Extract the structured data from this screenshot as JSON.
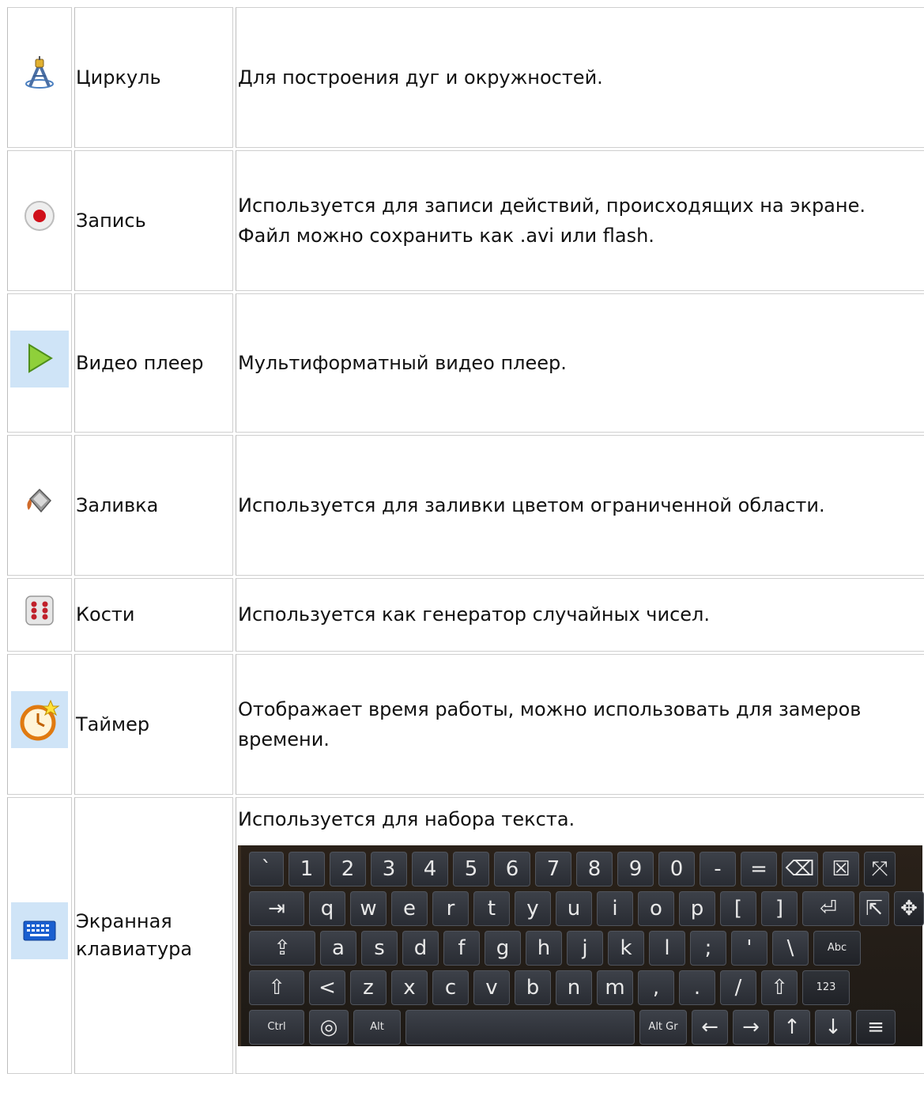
{
  "rows": [
    {
      "icon": "compass-icon",
      "name": "Циркуль",
      "desc": [
        "Для построения дуг и окружностей."
      ]
    },
    {
      "icon": "record-icon",
      "name": "Запись",
      "desc": [
        "Используется для записи действий, происходящих на экране.",
        "Файл можно сохранить как .avi или flash."
      ]
    },
    {
      "icon": "play-icon",
      "name": "Видео плеер",
      "desc": [
        "Мультиформатный видео плеер."
      ]
    },
    {
      "icon": "paint-bucket-icon",
      "name": "Заливка",
      "desc": [
        "Используется для заливки цветом ограниченной области."
      ]
    },
    {
      "icon": "dice-icon",
      "name": "Кости",
      "desc": [
        "Используется как генератор случайных чисел."
      ]
    },
    {
      "icon": "timer-icon",
      "name": "Таймер",
      "desc": [
        "Отображает время работы, можно использовать для замеров",
        "времени."
      ]
    },
    {
      "icon": "keyboard-icon",
      "name_lines": [
        "Экранная",
        "клавиатура"
      ],
      "desc": [
        "Используется для набора текста."
      ]
    }
  ],
  "keyboard": {
    "rows": [
      [
        "`",
        "1",
        "2",
        "3",
        "4",
        "5",
        "6",
        "7",
        "8",
        "9",
        "0",
        "-",
        "=",
        "⌫",
        "☒",
        "⤧"
      ],
      [
        "⇥",
        "q",
        "w",
        "e",
        "r",
        "t",
        "y",
        "u",
        "i",
        "o",
        "p",
        "[",
        "]",
        "⏎",
        "⇱",
        "✥"
      ],
      [
        "⇪",
        "a",
        "s",
        "d",
        "f",
        "g",
        "h",
        "j",
        "k",
        "l",
        ";",
        "'",
        "\\",
        "Abc"
      ],
      [
        "⇧",
        "<",
        "z",
        "x",
        "c",
        "v",
        "b",
        "n",
        "m",
        ",",
        ".",
        "/",
        "⇧",
        "123"
      ],
      [
        "Ctrl",
        "◎",
        "Alt",
        " ",
        "Alt Gr",
        "←",
        "→",
        "↑",
        "↓",
        "≡"
      ]
    ]
  }
}
